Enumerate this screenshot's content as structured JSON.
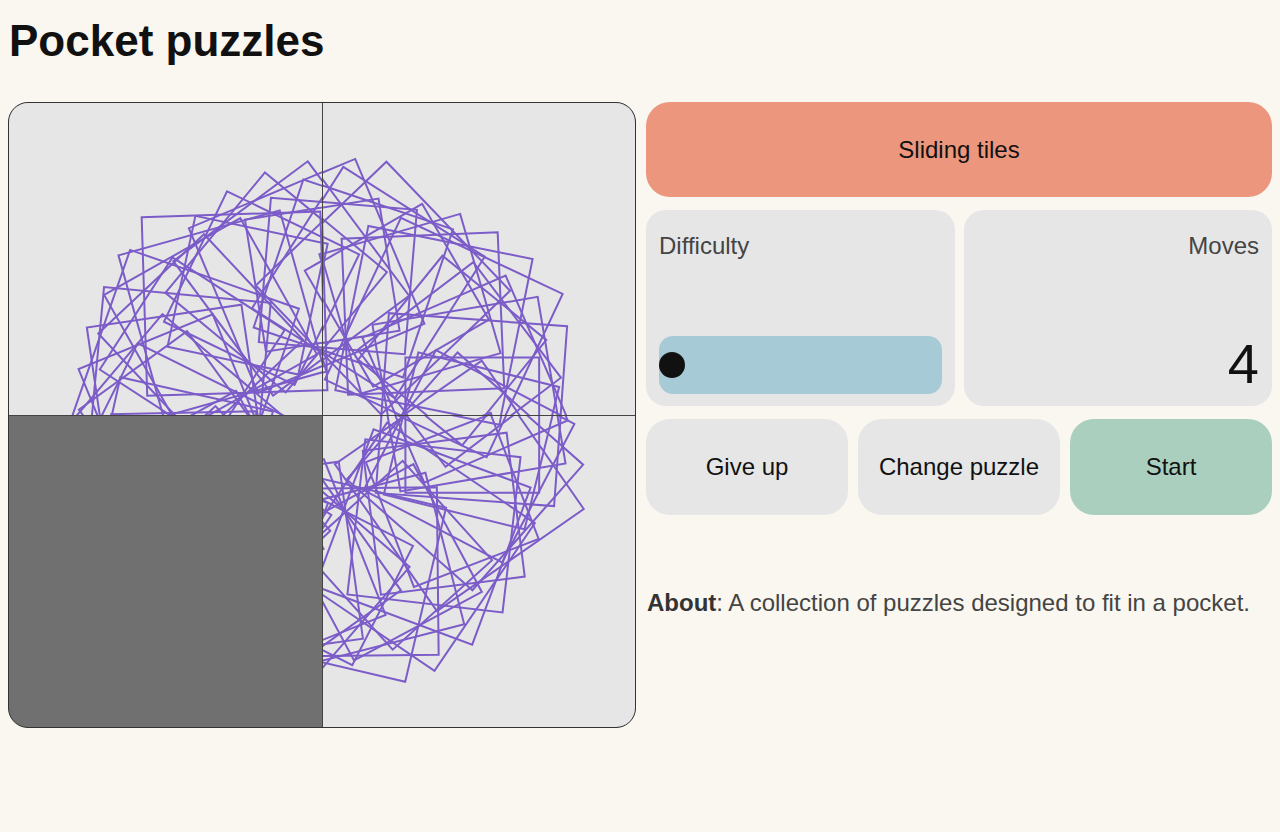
{
  "title": "Pocket puzzles",
  "board": {
    "tiles": [
      {
        "piece": 0,
        "empty": false
      },
      {
        "piece": 1,
        "empty": false
      },
      {
        "piece": 2,
        "empty": true
      },
      {
        "piece": 3,
        "empty": false
      }
    ]
  },
  "game": {
    "name": "Sliding tiles"
  },
  "difficulty": {
    "label": "Difficulty",
    "level": 0
  },
  "moves": {
    "label": "Moves",
    "value": "4"
  },
  "buttons": [
    {
      "label": "Give up",
      "primary": false
    },
    {
      "label": "Change puzzle",
      "primary": false
    },
    {
      "label": "Start",
      "primary": true
    }
  ],
  "about": {
    "heading": "About",
    "text": ": A collection of puzzles designed to fit in a pocket."
  }
}
